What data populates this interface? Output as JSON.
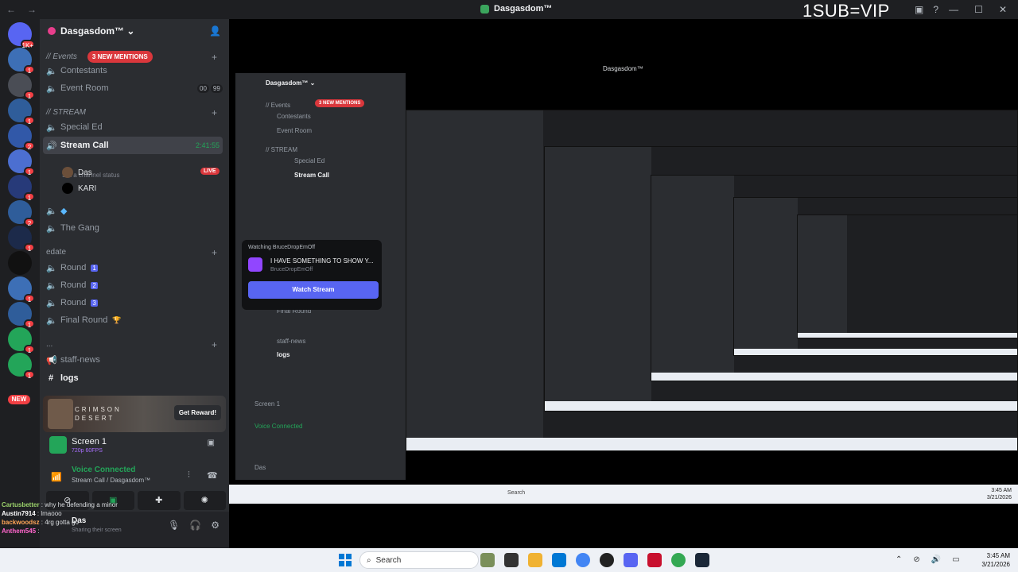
{
  "window": {
    "title": "Dasgasdom™",
    "overlay_text": "1SUB=VIP"
  },
  "guilds": {
    "badges": [
      "1K+",
      "1",
      "1",
      "1",
      "2",
      "1",
      "1",
      "2",
      "1",
      "1",
      "1",
      "1",
      "1",
      "1",
      "1",
      "1"
    ],
    "new_label": "NEW"
  },
  "server": {
    "name": "Dasgasdom™ ⌄",
    "categories": {
      "events": "// Events",
      "mentions": "3 NEW MENTIONS",
      "stream": "// STREAM",
      "edate": "edate",
      "misc": "..."
    },
    "channels": {
      "contestants": "Contestants",
      "event_room": "Event Room",
      "event_room_counts": [
        "00",
        "99"
      ],
      "special_ed": "Special Ed",
      "stream_call": "Stream Call",
      "stream_time": "2:41:55",
      "channel_status": "Set a channel status",
      "the_gang": "The Gang",
      "round1": "Round",
      "round2": "Round",
      "round3": "Round",
      "round1_num": "1",
      "round2_num": "2",
      "round3_num": "3",
      "final_round": "Final Round",
      "staff_news": "staff-news",
      "logs": "logs"
    },
    "voice_users": [
      {
        "name": "Das",
        "live": "LIVE"
      },
      {
        "name": "KARI"
      }
    ]
  },
  "promo": {
    "title_line1": "CRIMSON",
    "title_line2": "DESERT",
    "button": "Get Reward!"
  },
  "screen_share": {
    "name": "Screen 1",
    "quality": "720p 60FPS"
  },
  "voice": {
    "status": "Voice Connected",
    "channel": "Stream Call / Dasgasdom™"
  },
  "user": {
    "name": "Das",
    "status": "Sharing their screen"
  },
  "chat_overlay": [
    {
      "user": "Cartusbetter",
      "text": "why he defending a minor",
      "color": "#9ad06a"
    },
    {
      "user": "Austin7914",
      "text": "lmaooo",
      "color": "#ffffff"
    },
    {
      "user": "backwoodsz",
      "text": "4rg gotta go",
      "color": "#ffa657"
    },
    {
      "user": "Anthem545",
      "text": "",
      "color": "#ff66cc"
    }
  ],
  "popup": {
    "watching": "Watching BruceDropEmOff",
    "title": "I HAVE SOMETHING TO SHOW Y...",
    "subtitle": "BruceDropEmOff",
    "button": "Watch Stream"
  },
  "taskbar": {
    "search": "Search",
    "time": "3:45 AM",
    "date": "3/21/2026"
  },
  "colors": {
    "blurple": "#5865f2",
    "green": "#23a559",
    "red": "#da373c",
    "bg": "#1e1f22"
  }
}
